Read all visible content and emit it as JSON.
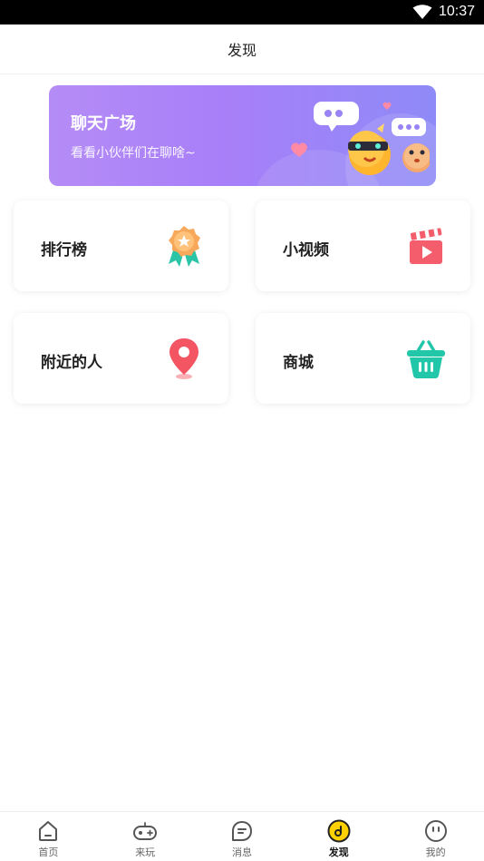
{
  "status_bar": {
    "time": "10:37",
    "wifi_icon": "wifi-icon"
  },
  "header": {
    "title": "发现"
  },
  "banner": {
    "title": "聊天广场",
    "subtitle": "看看小伙伴们在聊啥~"
  },
  "cards": {
    "rank": {
      "label": "排行榜",
      "icon": "medal-icon"
    },
    "video": {
      "label": "小视频",
      "icon": "clapperboard-icon"
    },
    "nearby": {
      "label": "附近的人",
      "icon": "location-pin-icon"
    },
    "shop": {
      "label": "商城",
      "icon": "basket-icon"
    }
  },
  "bottom_nav": {
    "items": [
      {
        "label": "首页",
        "icon": "home-icon"
      },
      {
        "label": "来玩",
        "icon": "gamepad-icon"
      },
      {
        "label": "消息",
        "icon": "message-icon"
      },
      {
        "label": "发现",
        "icon": "discover-icon",
        "active": true
      },
      {
        "label": "我的",
        "icon": "profile-icon"
      }
    ]
  },
  "colors": {
    "accent_yellow": "#ffd100",
    "banner_purple": "#a87ff8",
    "pin_red": "#f35562",
    "basket_teal": "#22c7a9"
  }
}
